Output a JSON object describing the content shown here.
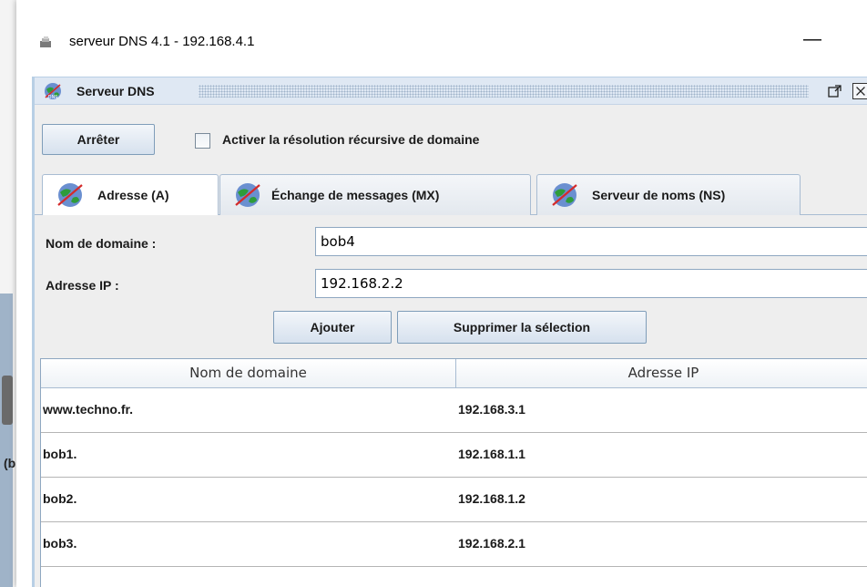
{
  "window": {
    "title": "serveur DNS 4.1 - 192.168.4.1",
    "minimize_glyph": "—"
  },
  "desktop": {
    "partial_label": "(b"
  },
  "frame": {
    "title": "Serveur DNS"
  },
  "controls": {
    "stop_label": "Arrêter",
    "recursive_checkbox_label": "Activer la résolution récursive de domaine",
    "recursive_checked": false
  },
  "tabs": [
    {
      "label": "Adresse (A)",
      "active": true
    },
    {
      "label": "Échange de messages (MX)",
      "active": false
    },
    {
      "label": "Serveur de noms (NS)",
      "active": false
    }
  ],
  "form": {
    "domain_label": "Nom de domaine :",
    "domain_value": "bob4",
    "ip_label": "Adresse IP :",
    "ip_value": "192.168.2.2",
    "add_label": "Ajouter",
    "delete_label": "Supprimer la sélection"
  },
  "table": {
    "headers": [
      "Nom de domaine",
      "Adresse IP"
    ],
    "rows": [
      [
        "www.techno.fr.",
        "192.168.3.1"
      ],
      [
        "bob1.",
        "192.168.1.1"
      ],
      [
        "bob2.",
        "192.168.1.2"
      ],
      [
        "bob3.",
        "192.168.2.1"
      ]
    ]
  },
  "icons": {
    "window_icon": "network-device-icon",
    "dns_icon": "dns-globe-icon",
    "maximize": "maximize-icon",
    "close": "close-icon"
  }
}
